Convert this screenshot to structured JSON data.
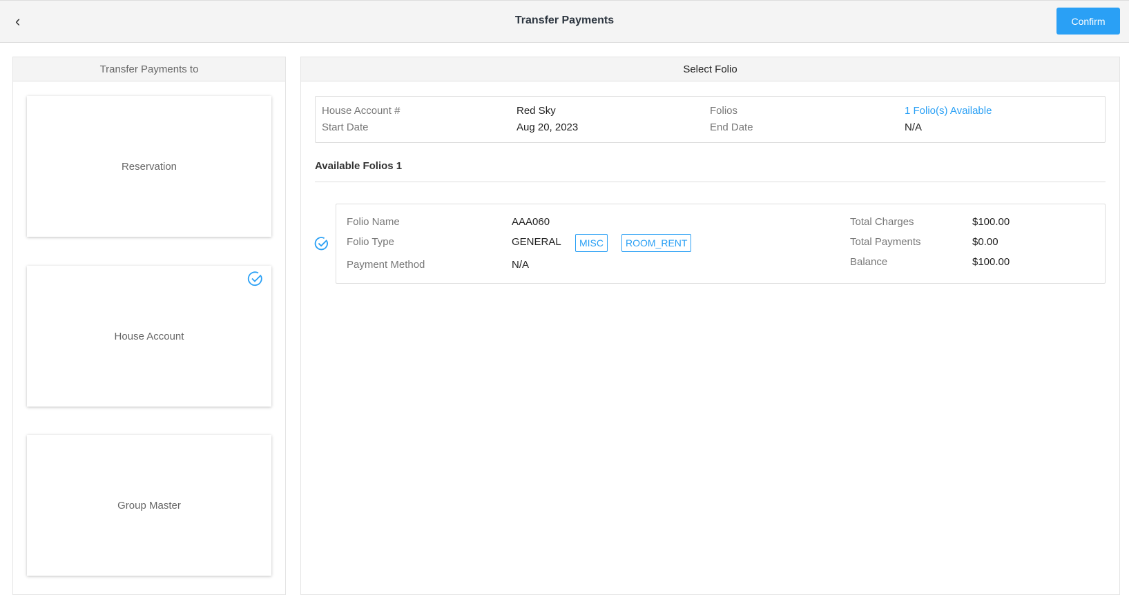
{
  "header": {
    "title": "Transfer Payments",
    "confirm_label": "Confirm"
  },
  "left": {
    "title": "Transfer Payments to",
    "options": [
      {
        "label": "Reservation",
        "selected": false
      },
      {
        "label": "House Account",
        "selected": true
      },
      {
        "label": "Group Master",
        "selected": false
      }
    ]
  },
  "right": {
    "title": "Select Folio",
    "info": {
      "house_account_label": "House Account #",
      "house_account_value": "Red Sky",
      "start_date_label": "Start Date",
      "start_date_value": "Aug 20, 2023",
      "folios_label": "Folios",
      "folios_value": "1 Folio(s) Available",
      "end_date_label": "End Date",
      "end_date_value": "N/A"
    },
    "available_title": "Available Folios 1",
    "folio": {
      "name_label": "Folio Name",
      "name_value": "AAA060",
      "type_label": "Folio Type",
      "type_value": "GENERAL",
      "tags": [
        "MISC",
        "ROOM_RENT"
      ],
      "payment_method_label": "Payment Method",
      "payment_method_value": "N/A",
      "total_charges_label": "Total Charges",
      "total_charges_value": "$100.00",
      "total_payments_label": "Total Payments",
      "total_payments_value": "$0.00",
      "balance_label": "Balance",
      "balance_value": "$100.00"
    }
  },
  "colors": {
    "accent": "#2aa0f5"
  }
}
